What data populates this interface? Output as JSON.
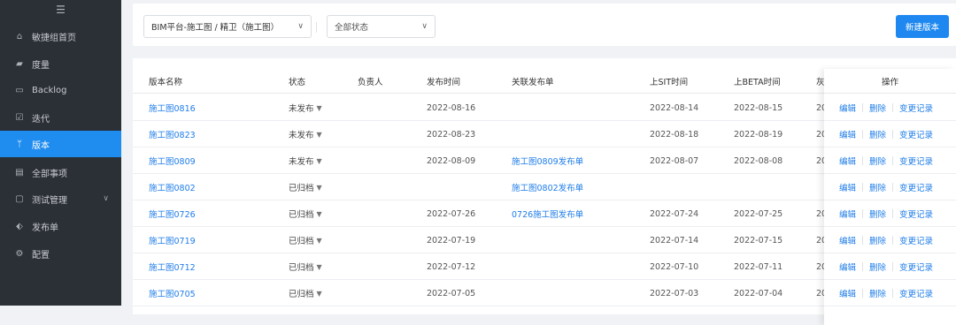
{
  "sidebar": {
    "toggle_icon": "menu-fold-icon",
    "items": [
      {
        "label": "敏捷组首页",
        "icon": "home-icon",
        "glyph": "⌂"
      },
      {
        "label": "度量",
        "icon": "chart-icon",
        "glyph": "▰"
      },
      {
        "label": "Backlog",
        "icon": "backlog-icon",
        "glyph": "▭"
      },
      {
        "label": "迭代",
        "icon": "iteration-icon",
        "glyph": "☑"
      },
      {
        "label": "版本",
        "icon": "branch-icon",
        "glyph": "ᛘ"
      },
      {
        "label": "全部事项",
        "icon": "list-icon",
        "glyph": "▤"
      },
      {
        "label": "测试管理",
        "icon": "test-icon",
        "glyph": "▢"
      },
      {
        "label": "发布单",
        "icon": "release-icon",
        "glyph": "⬖"
      },
      {
        "label": "配置",
        "icon": "settings-icon",
        "glyph": "⚙"
      }
    ],
    "active_index": 4
  },
  "toolbar": {
    "project_select": "BIM平台-施工图 / 精卫（施工图）",
    "status_select": "全部状态",
    "new_button": "新建版本"
  },
  "table": {
    "headers": {
      "name": "版本名称",
      "status": "状态",
      "owner": "负责人",
      "publish_time": "发布时间",
      "release": "关联发布单",
      "sit_time": "上SIT时间",
      "beta_time": "上BETA时间",
      "truncated": "灰",
      "ops": "操作"
    },
    "rows": [
      {
        "name": "施工图0816",
        "name_link": true,
        "status": "未发布",
        "owner": "",
        "publish_time": "2022-08-16",
        "release": "",
        "sit_time": "2022-08-14",
        "beta_time": "2022-08-15",
        "truncated": "20"
      },
      {
        "name": "施工图0823",
        "name_link": true,
        "status": "未发布",
        "owner": "",
        "publish_time": "2022-08-23",
        "release": "",
        "sit_time": "2022-08-18",
        "beta_time": "2022-08-19",
        "truncated": "20"
      },
      {
        "name": "施工图0809",
        "name_link": true,
        "status": "未发布",
        "owner": "",
        "publish_time": "2022-08-09",
        "release": "施工图0809发布单",
        "sit_time": "2022-08-07",
        "beta_time": "2022-08-08",
        "truncated": "20"
      },
      {
        "name": "施工图0802",
        "name_link": true,
        "status": "已归档",
        "owner": "",
        "publish_time": "",
        "release": "施工图0802发布单",
        "sit_time": "",
        "beta_time": "",
        "truncated": ""
      },
      {
        "name": "施工图0726",
        "name_link": true,
        "status": "已归档",
        "owner": "",
        "publish_time": "2022-07-26",
        "release": "0726施工图发布单",
        "sit_time": "2022-07-24",
        "beta_time": "2022-07-25",
        "truncated": "20"
      },
      {
        "name": "施工图0719",
        "name_link": true,
        "status": "已归档",
        "owner": "",
        "publish_time": "2022-07-19",
        "release": "",
        "sit_time": "2022-07-14",
        "beta_time": "2022-07-15",
        "truncated": "20"
      },
      {
        "name": "施工图0712",
        "name_link": true,
        "status": "已归档",
        "owner": "",
        "publish_time": "2022-07-12",
        "release": "",
        "sit_time": "2022-07-10",
        "beta_time": "2022-07-11",
        "truncated": "20"
      },
      {
        "name": "施工图0705",
        "name_link": true,
        "status": "已归档",
        "owner": "",
        "publish_time": "2022-07-05",
        "release": "",
        "sit_time": "2022-07-03",
        "beta_time": "2022-07-04",
        "truncated": "20"
      }
    ],
    "actions": {
      "edit": "编辑",
      "delete": "删除",
      "history": "变更记录"
    }
  },
  "colors": {
    "sidebar_bg": "#2b2f36",
    "sidebar_active": "#1f8cf0",
    "link": "#1f7de8",
    "primary_button": "#1e88f0"
  }
}
